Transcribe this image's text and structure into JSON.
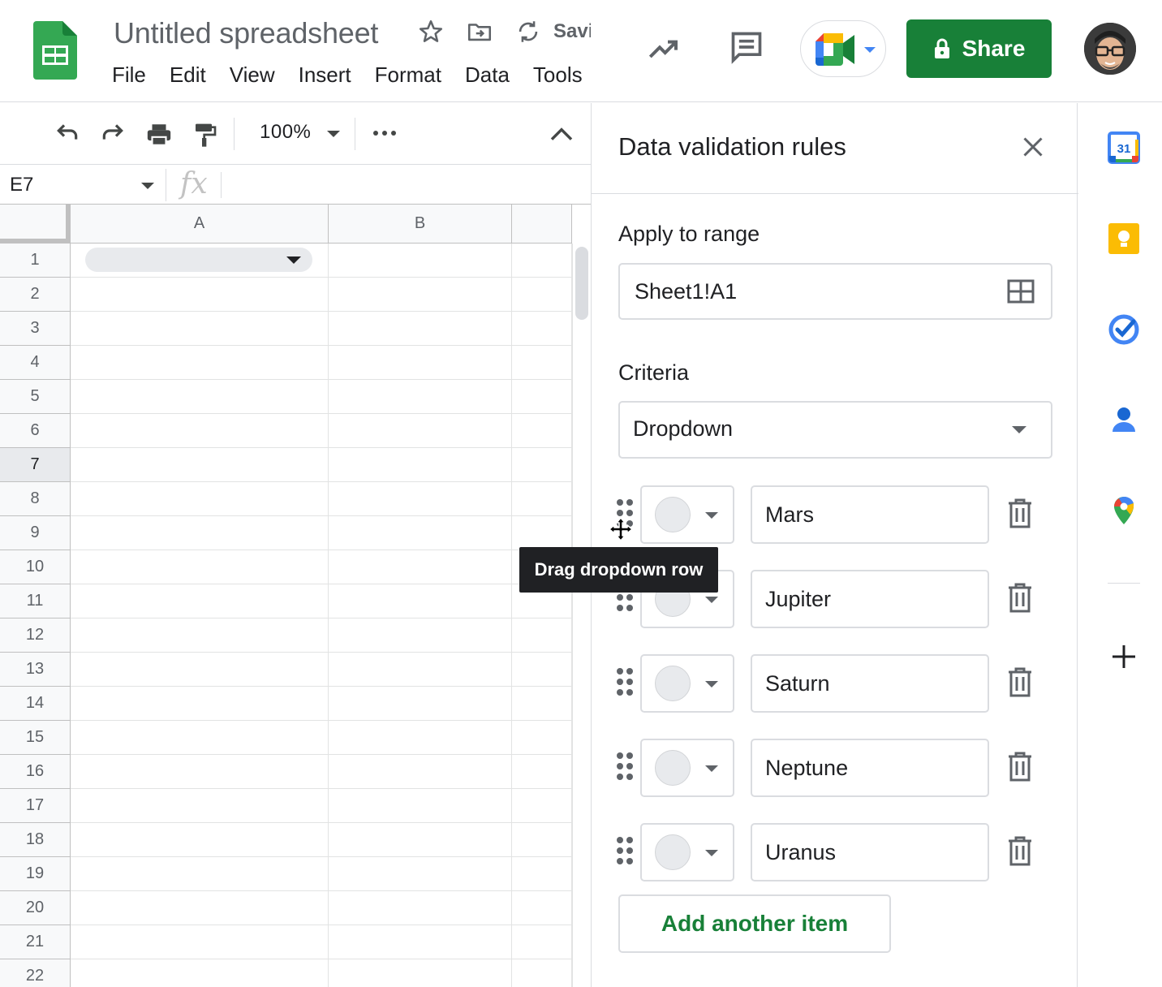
{
  "document": {
    "title": "Untitled spreadsheet",
    "saving_status": "Saving..."
  },
  "menubar": {
    "items": [
      "File",
      "Edit",
      "View",
      "Insert",
      "Format",
      "Data",
      "Tools"
    ]
  },
  "header": {
    "share_label": "Share"
  },
  "toolbar": {
    "zoom": "100%"
  },
  "formula_bar": {
    "cell_reference": "E7",
    "fx_label": "fx"
  },
  "grid": {
    "columns": [
      "A",
      "B",
      ""
    ],
    "rows": [
      "1",
      "2",
      "3",
      "4",
      "5",
      "6",
      "7",
      "8",
      "9",
      "10",
      "11",
      "12",
      "13",
      "14",
      "15",
      "16",
      "17",
      "18",
      "19",
      "20",
      "21",
      "22"
    ],
    "active_row": "7"
  },
  "panel": {
    "title": "Data validation rules",
    "apply_to_range_label": "Apply to range",
    "range_value": "Sheet1!A1",
    "criteria_label": "Criteria",
    "criteria_value": "Dropdown",
    "items": [
      {
        "value": "Mars",
        "color": "#e8eaed"
      },
      {
        "value": "Jupiter",
        "color": "#e8eaed"
      },
      {
        "value": "Saturn",
        "color": "#e8eaed"
      },
      {
        "value": "Neptune",
        "color": "#e8eaed"
      },
      {
        "value": "Uranus",
        "color": "#e8eaed"
      }
    ],
    "add_item_label": "Add another item"
  },
  "tooltip": {
    "text": "Drag dropdown row"
  },
  "right_rail": {
    "calendar_day": "31",
    "icons": [
      "calendar-icon",
      "keep-icon",
      "tasks-icon",
      "contacts-icon",
      "maps-icon",
      "add-icon"
    ]
  },
  "colors": {
    "accent_green": "#188038",
    "sheets_green": "#34a853",
    "tooltip_bg": "#202124",
    "border": "#dadce0"
  }
}
